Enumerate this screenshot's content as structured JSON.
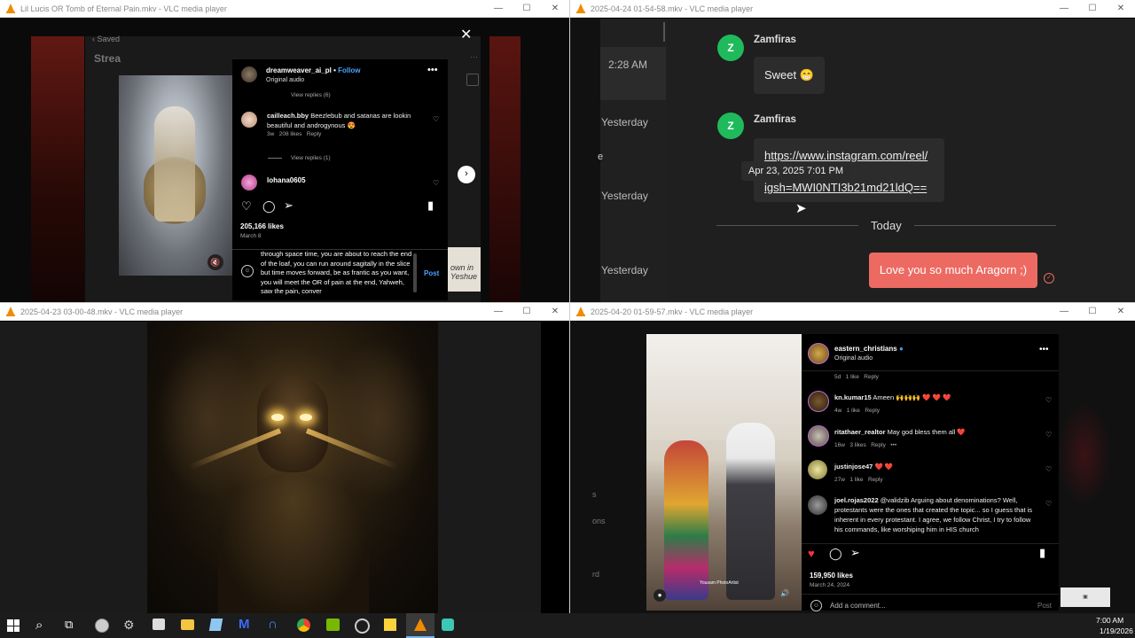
{
  "win1": {
    "title": "Lil Lucis OR Tomb of Eternal Pain.mkv - VLC media player",
    "saved_label": "Saved",
    "stream_label": "Strea",
    "post_user": "dreamweaver_ai_pl",
    "follow": "Follow",
    "original_audio": "Original audio",
    "view_replies_top": "View replies (6)",
    "comment1_user": "cailleach.bby",
    "comment1_text": "Beezlebub and satanas are lookin beautiful and androgynous 😍",
    "comment1_age": "3w",
    "comment1_likes": "208 likes",
    "reply": "Reply",
    "view_replies_1": "View replies (1)",
    "comment2_user": "lohana0605",
    "likes": "205,166 likes",
    "date": "March 8",
    "typed_text": "through space time, you are about to reach the end of the loaf, you can run around sagitally in the slice but time moves forward, be as frantic as you want, you will meet the OR of pain at the end, Yahweh, saw the pain, conver",
    "post": "Post",
    "right_box_text": "own in Yeshue"
  },
  "win2": {
    "title": "2025-04-24 01-54-58.mkv - VLC media player",
    "time1": "2:28 AM",
    "yesterday": "Yesterday",
    "sender": "Zamfiras",
    "avatar_letter": "Z",
    "msg1": "Sweet 😁",
    "link_line1": "https://www.instagram.com/reel/",
    "link_line2": "igsh=MWI0NTI3b21md21ldQ==",
    "tooltip": "Apr 23, 2025 7:01 PM",
    "today": "Today",
    "my_msg": "Love you so much Aragorn ;)"
  },
  "win3": {
    "title": "2025-04-23 03-00-48.mkv - VLC media player"
  },
  "win4": {
    "title": "2025-04-20 01-59-57.mkv - VLC media player",
    "user": "eastern_christians",
    "original_audio": "Original audio",
    "top_meta": "5d",
    "top_likes": "1 like",
    "reply": "Reply",
    "c1_user": "kn.kumar15",
    "c1_text": "Ameen 🙌🙌🙌 ❤️ ❤️ ❤️",
    "c1_age": "4w",
    "c2_user": "ritathaer_realtor",
    "c2_text": "May god bless them all ❤️",
    "c2_age": "16w",
    "c2_likes": "3 likes",
    "c3_user": "justinjose47",
    "c3_text": "❤️ ❤️",
    "c3_age": "27w",
    "c4_user": "joel.rojas2022",
    "c4_text": "@validzib Arguing about denominations? Well, protestants were the ones that created the topic... so I guess that is inherent in every protestant. I agree, we follow Christ, I try to follow his commands, like worshiping him in HIS church",
    "likes": "159,950 likes",
    "date": "March 24, 2024",
    "add_comment": "Add a comment...",
    "post": "Post",
    "watermark": "Yousam PhotoArtist",
    "left_fragments": [
      "s",
      "ons",
      "rd"
    ]
  },
  "taskbar": {
    "time": "7:00 AM",
    "date": "1/19/2026"
  }
}
